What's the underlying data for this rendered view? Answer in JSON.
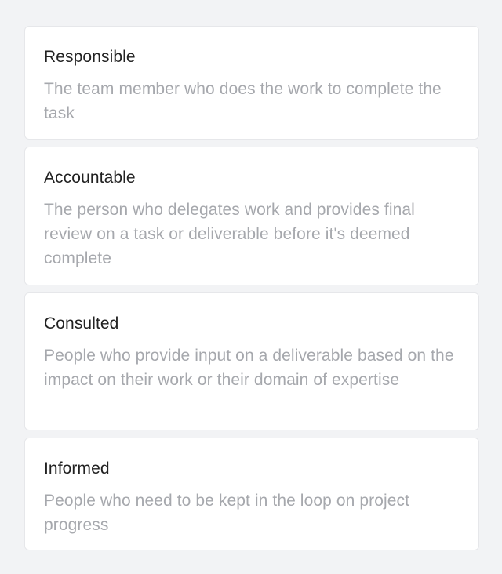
{
  "roles": [
    {
      "title": "Responsible",
      "description": "The team member who does the work to complete the task"
    },
    {
      "title": "Accountable",
      "description": "The person who delegates work and provides final review on a task or deliverable before it's deemed complete"
    },
    {
      "title": "Consulted",
      "description": "People who provide input on a deliverable based on the impact on their work or their domain of expertise"
    },
    {
      "title": "Informed",
      "description": "People who need to be kept in the loop on project progress"
    }
  ]
}
